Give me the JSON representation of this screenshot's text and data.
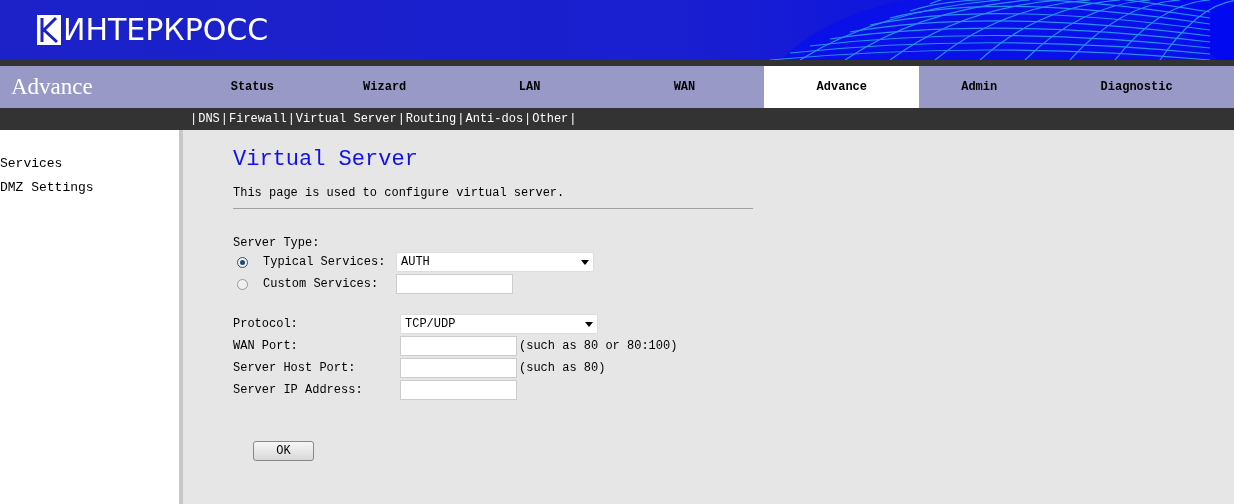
{
  "header": {
    "logo_text": "ИНТЕРКРОСС"
  },
  "nav": {
    "section_title": "Advance",
    "tabs": [
      {
        "label": "Status",
        "selected": false
      },
      {
        "label": "Wizard",
        "selected": false
      },
      {
        "label": "LAN",
        "selected": false
      },
      {
        "label": "WAN",
        "selected": false
      },
      {
        "label": "Advance",
        "selected": true
      },
      {
        "label": "Admin",
        "selected": false
      },
      {
        "label": "Diagnostic",
        "selected": false
      }
    ]
  },
  "subnav": {
    "separator": "|",
    "items": [
      "DNS",
      "Firewall",
      "Virtual Server",
      "Routing",
      "Anti-dos",
      "Other"
    ]
  },
  "sidebar": {
    "items": [
      "Services",
      "DMZ Settings"
    ]
  },
  "content": {
    "title": "Virtual Server",
    "description": "This page is used to configure virtual server.",
    "server_type_label": "Server Type:",
    "server_types": [
      {
        "label": "Typical Services:",
        "selected": true,
        "kind": "select",
        "value": "AUTH"
      },
      {
        "label": "Custom Services:",
        "selected": false,
        "kind": "input"
      }
    ],
    "fields": [
      {
        "label": "Protocol:",
        "kind": "select",
        "value": "TCP/UDP"
      },
      {
        "label": "WAN Port:",
        "kind": "input",
        "hint": "(such as 80 or 80:100)"
      },
      {
        "label": "Server Host Port:",
        "kind": "input",
        "hint": "(such as 80)"
      },
      {
        "label": "Server IP Address:",
        "kind": "input"
      }
    ],
    "ok_button": "OK"
  }
}
